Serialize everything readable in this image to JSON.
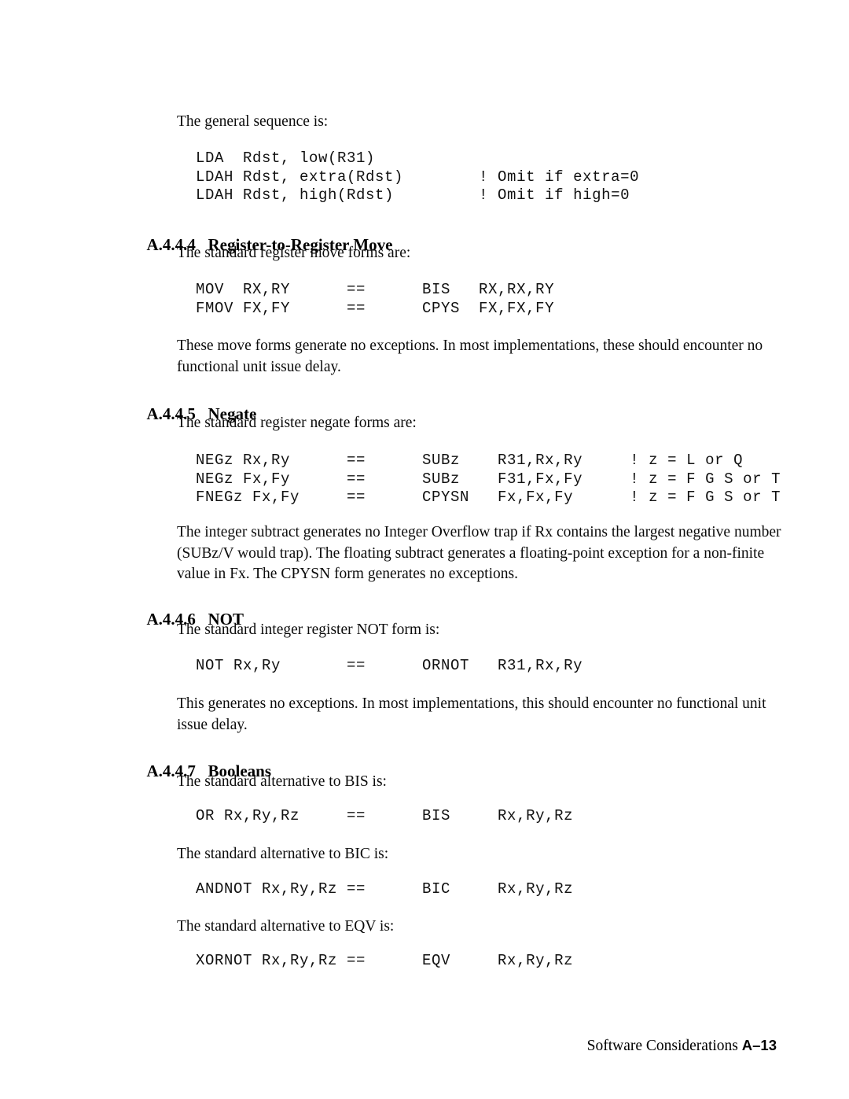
{
  "document": {
    "page_label": "A–13",
    "footer_title": "Software Considerations"
  },
  "blocks": {
    "intro_para": "The general sequence is:",
    "code_general_sequence": "LDA  Rdst, low(R31)\nLDAH Rdst, extra(Rdst)        ! Omit if extra=0\nLDAH Rdst, high(Rdst)         ! Omit if high=0",
    "sec_444_num": "A.4.4.4",
    "sec_444_title": "Register-to-Register Move",
    "sec_444_para": "The standard register move forms are:",
    "code_move": "MOV  RX,RY      ==      BIS   RX,RX,RY\nFMOV FX,FY      ==      CPYS  FX,FX,FY",
    "sec_444_after": "These move forms generate no exceptions. In most implementations, these should encounter no functional unit issue delay.",
    "sec_445_num": "A.4.4.5",
    "sec_445_title": "Negate",
    "sec_445_para": "The standard register negate forms are:",
    "code_negate": "NEGz Rx,Ry      ==      SUBz    R31,Rx,Ry     ! z = L or Q\nNEGz Fx,Fy      ==      SUBz    F31,Fx,Fy     ! z = F G S or T\nFNEGz Fx,Fy     ==      CPYSN   Fx,Fx,Fy      ! z = F G S or T",
    "sec_445_after": "The integer subtract generates no Integer Overflow trap if Rx contains the largest negative number (SUBz/V would trap). The floating subtract generates a floating-point exception for a non-finite value in Fx. The CPYSN form generates no exceptions.",
    "sec_446_num": "A.4.4.6",
    "sec_446_title": "NOT",
    "sec_446_para": "The standard integer register NOT form is:",
    "code_not": "NOT Rx,Ry       ==      ORNOT   R31,Rx,Ry",
    "sec_446_after": "This generates no exceptions. In most implementations, this should encounter no functional unit issue delay.",
    "sec_447_num": "A.4.4.7",
    "sec_447_title": "Booleans",
    "sec_447_para_bis": "The standard alternative to BIS is:",
    "code_or": "OR Rx,Ry,Rz     ==      BIS     Rx,Ry,Rz",
    "sec_447_para_bic": "The standard alternative to BIC is:",
    "code_andnot": "ANDNOT Rx,Ry,Rz ==      BIC     Rx,Ry,Rz",
    "sec_447_para_eqv": "The standard alternative to EQV is:",
    "code_xornot": "XORNOT Rx,Ry,Rz ==      EQV     Rx,Ry,Rz"
  }
}
